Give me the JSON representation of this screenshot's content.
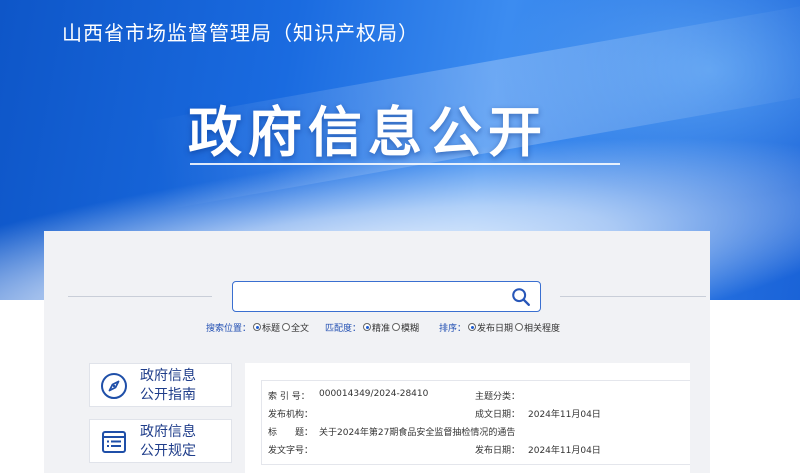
{
  "header": {
    "org_title": "山西省市场监督管理局（知识产权局）",
    "hero_title": "政府信息公开"
  },
  "search": {
    "input_value": "",
    "placeholder": "",
    "scope_label": "搜索位置：",
    "scope_options": [
      {
        "label": "标题",
        "selected": true
      },
      {
        "label": "全文",
        "selected": false
      }
    ],
    "match_label": "匹配度：",
    "match_options": [
      {
        "label": "精准",
        "selected": true
      },
      {
        "label": "模糊",
        "selected": false
      }
    ],
    "sort_label": "排序：",
    "sort_options": [
      {
        "label": "发布日期",
        "selected": true
      },
      {
        "label": "相关程度",
        "selected": false
      }
    ]
  },
  "nav": [
    {
      "line1": "政府信息",
      "line2": "公开指南",
      "icon": "compass-icon"
    },
    {
      "line1": "政府信息",
      "line2": "公开规定",
      "icon": "list-document-icon"
    }
  ],
  "info": {
    "index_label": "索 引 号：",
    "index_value": "000014349/2024-28410",
    "category_label": "主题分类：",
    "category_value": "",
    "publisher_label": "发布机构：",
    "publisher_value": "",
    "created_label": "成文日期：",
    "created_value": "2024年11月04日",
    "title_label": "标　　题：",
    "title_value": "关于2024年第27期食品安全监督抽检情况的通告",
    "docno_label": "发文字号：",
    "docno_value": "",
    "published_label": "发布日期：",
    "published_value": "2024年11月04日"
  },
  "colors": {
    "brand_blue": "#1a63d8",
    "accent_text": "#1f3d8a",
    "panel_bg": "#f1f2f5"
  }
}
